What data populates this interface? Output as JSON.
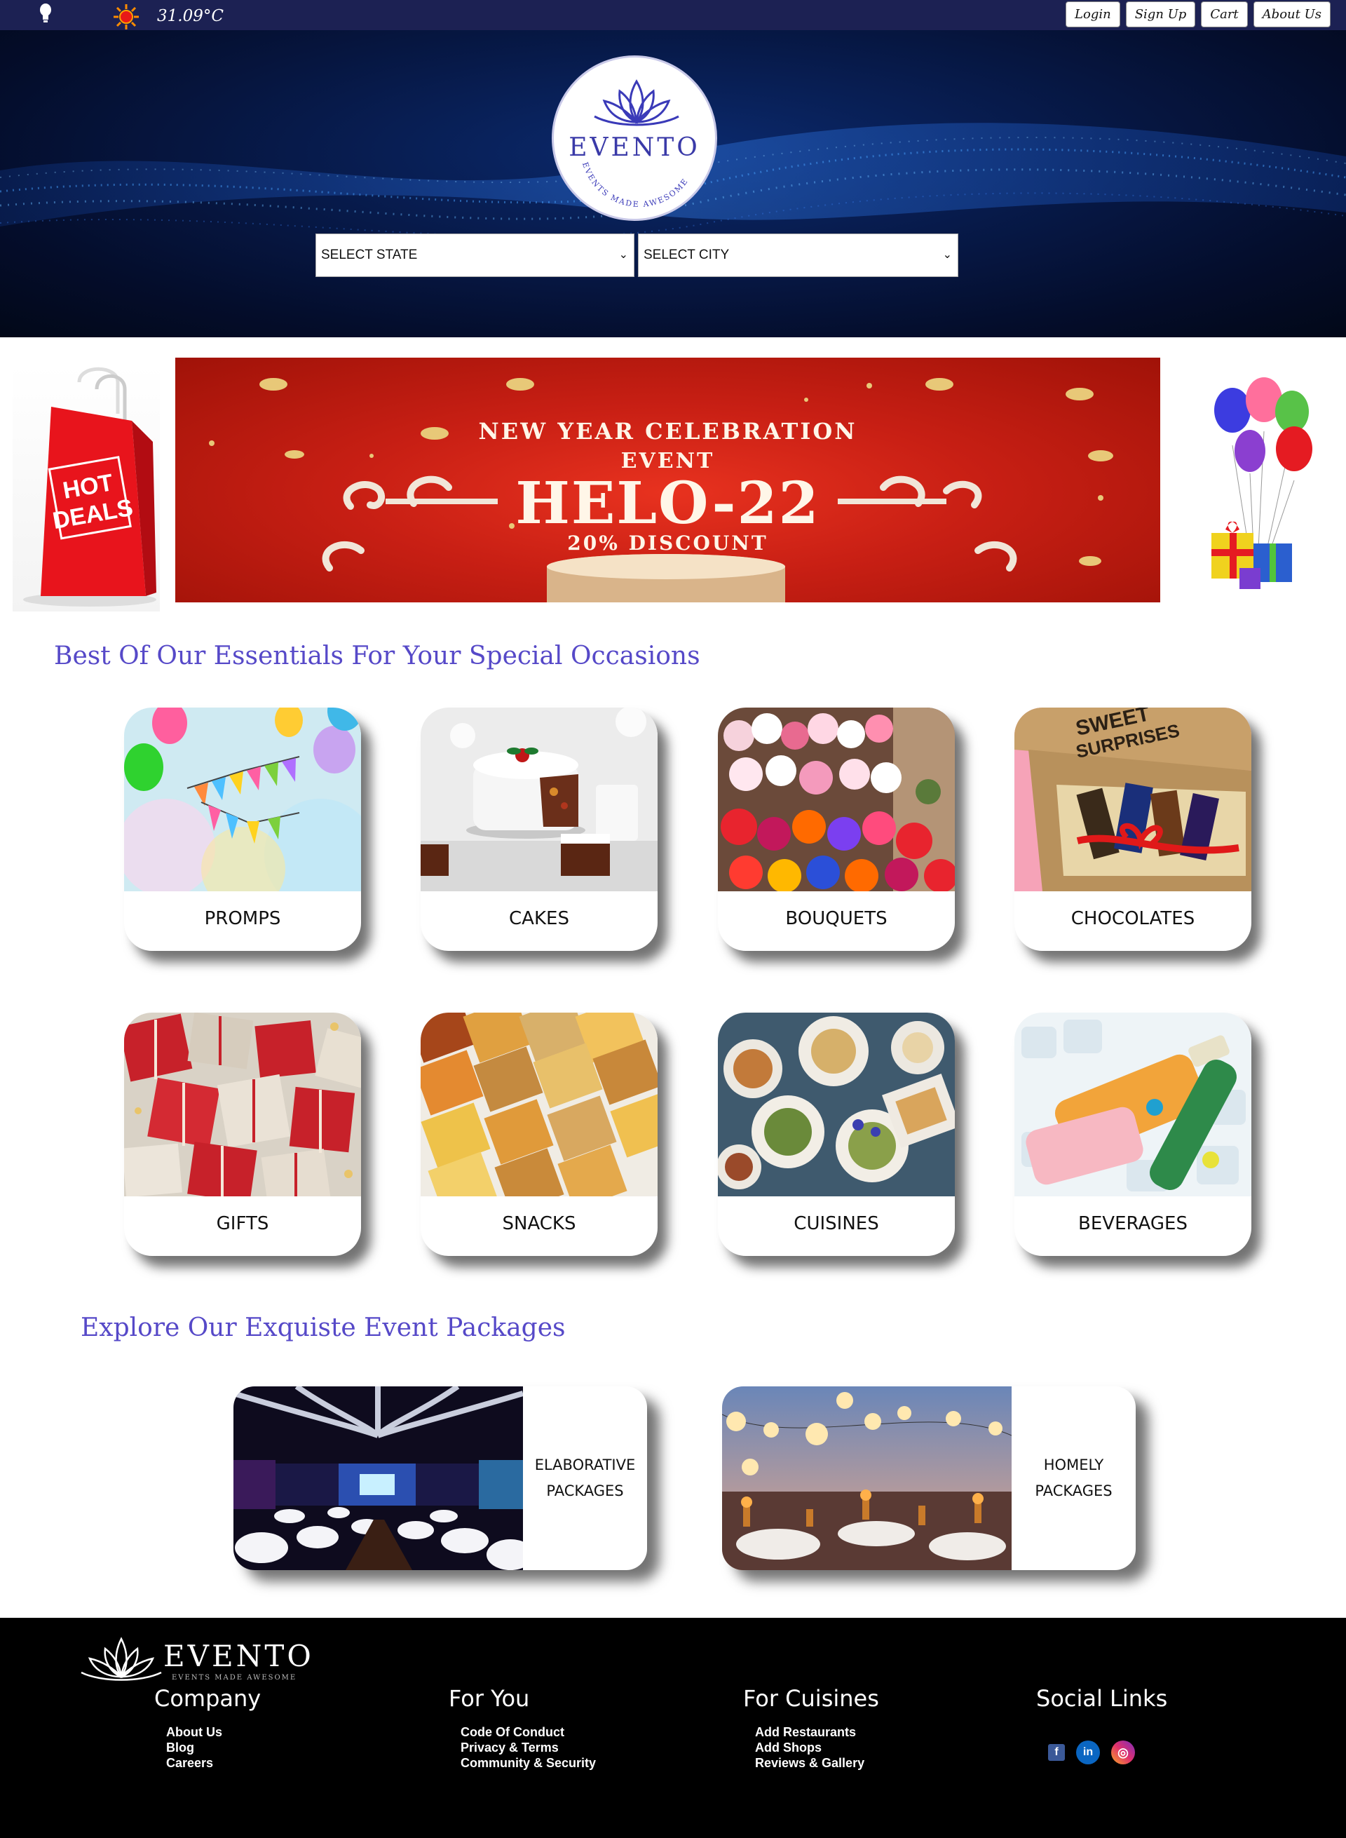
{
  "topbar": {
    "temperature": "31.09°C",
    "nav": [
      "Login",
      "Sign Up",
      "Cart",
      "About Us"
    ]
  },
  "hero": {
    "logo_word": "EVENTO",
    "logo_tagline": "EVENTS MADE AWESOME",
    "select_state": "SELECT STATE",
    "select_city": "SELECT CITY"
  },
  "promo": {
    "hot_deals_line1": "HOT",
    "hot_deals_line2": "DEALS",
    "banner_line1": "NEW YEAR CELEBRATION",
    "banner_line2": "EVENT",
    "banner_code": "HELO-22",
    "banner_discount": "20% DISCOUNT"
  },
  "essentials": {
    "title": "Best Of Our Essentials For Your Special Occasions",
    "items": [
      "PROMPS",
      "CAKES",
      "BOUQUETS",
      "CHOCOLATES",
      "GIFTS",
      "SNACKS",
      "CUISINES",
      "BEVERAGES"
    ]
  },
  "packages": {
    "title": "Explore Our Exquiste Event Packages",
    "items": [
      {
        "line1": "ELABORATIVE",
        "line2": "PACKAGES"
      },
      {
        "line1": "HOMELY",
        "line2": "PACKAGES"
      }
    ]
  },
  "footer": {
    "brand": "EVENTO",
    "tagline": "EVENTS MADE AWESOME",
    "columns": [
      {
        "title": "Company",
        "links": [
          "About Us",
          "Blog",
          "Careers"
        ]
      },
      {
        "title": "For You",
        "links": [
          "Code Of Conduct",
          "Privacy & Terms",
          "Community & Security"
        ]
      },
      {
        "title": "For Cuisines",
        "links": [
          "Add Restaurants",
          "Add Shops",
          "Reviews & Gallery"
        ]
      },
      {
        "title": "Social Links",
        "links": []
      }
    ],
    "social": [
      {
        "icon": "facebook-icon",
        "glyph": "f",
        "color": "#3b5998"
      },
      {
        "icon": "linkedin-icon",
        "glyph": "in",
        "color": "#0a66c2"
      },
      {
        "icon": "instagram-icon",
        "glyph": "◎",
        "color": "#c13584"
      }
    ]
  },
  "colors": {
    "topbar": "#1c2153",
    "heading": "#5649c8",
    "footer": "#000000"
  }
}
